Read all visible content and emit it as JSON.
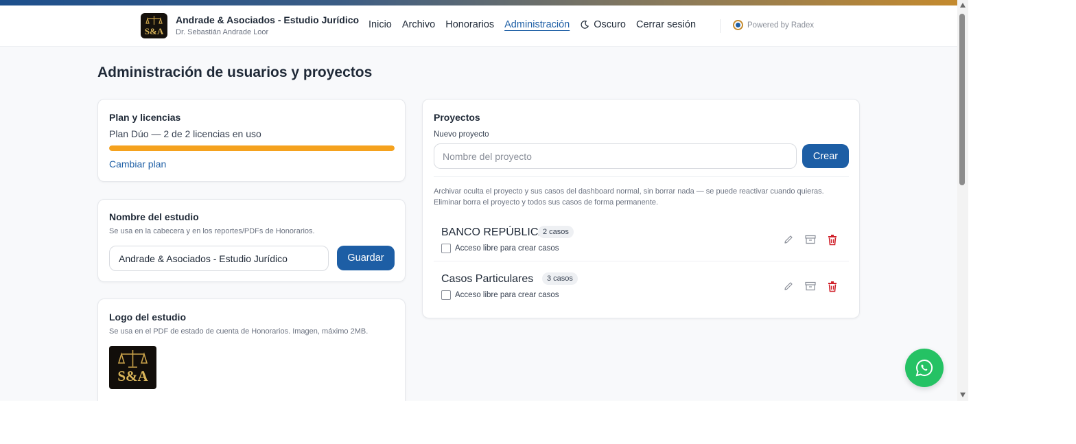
{
  "header": {
    "brand_title": "Andrade & Asociados - Estudio Jurídico",
    "brand_subtitle": "Dr. Sebastián Andrade Loor",
    "logo_text": "S&A",
    "nav": {
      "inicio": "Inicio",
      "archivo": "Archivo",
      "honorarios": "Honorarios",
      "administracion": "Administración",
      "oscuro": "Oscuro",
      "cerrar_sesion": "Cerrar sesión"
    },
    "powered_by": "Powered by Radex"
  },
  "page": {
    "title": "Administración de usuarios y proyectos"
  },
  "plan": {
    "title": "Plan y licencias",
    "usage_text": "Plan Dúo — 2 de 2 licencias en uso",
    "usage_fraction": 1.0,
    "change_link": "Cambiar plan"
  },
  "studio": {
    "title": "Nombre del estudio",
    "subtitle": "Se usa en la cabecera y en los reportes/PDFs de Honorarios.",
    "name_value": "Andrade & Asociados - Estudio Jurídico",
    "save_label": "Guardar"
  },
  "logo_card": {
    "title": "Logo del estudio",
    "subtitle": "Se usa en el PDF de estado de cuenta de Honorarios. Imagen, máximo 2MB."
  },
  "projects": {
    "title": "Proyectos",
    "new_label": "Nuevo proyecto",
    "input_placeholder": "Nombre del proyecto",
    "create_label": "Crear",
    "help_text": "Archivar oculta el proyecto y sus casos del dashboard normal, sin borrar nada — se puede reactivar cuando quieras. Eliminar borra el proyecto y todos sus casos de forma permanente.",
    "items": [
      {
        "name": "BANCO REPÚBLICA",
        "badge": "2 casos",
        "checkbox_label": "Acceso libre para crear casos"
      },
      {
        "name": "Casos Particulares",
        "badge": "3 casos",
        "checkbox_label": "Acceso libre para crear casos"
      }
    ]
  },
  "colors": {
    "primary": "#1d5ea5",
    "progress": "#f5a21e",
    "danger": "#d0202a",
    "whatsapp": "#25c264"
  }
}
